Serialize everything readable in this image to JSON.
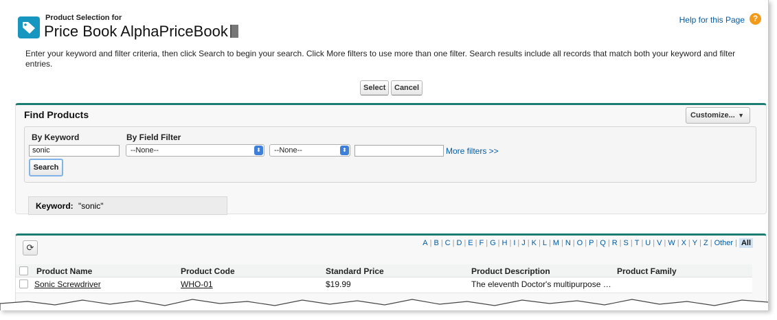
{
  "header": {
    "subtitle": "Product Selection for",
    "title": "Price Book AlphaPriceBook",
    "help_link": "Help for this Page",
    "help_icon": "?"
  },
  "instructions": "Enter your keyword and filter criteria, then click Search to begin your search. Click More filters to use more than one filter. Search results include all records that match both your keyword and filter entries.",
  "actions": {
    "select_label": "Select",
    "cancel_label": "Cancel"
  },
  "find_products": {
    "title": "Find Products",
    "customize_label": "Customize...",
    "by_keyword_label": "By Keyword",
    "by_field_filter_label": "By Field Filter",
    "keyword_value": "sonic",
    "field_select_value": "--None--",
    "operator_select_value": "--None--",
    "filter_value": "",
    "more_filters_link": "More filters >>",
    "search_label": "Search",
    "keyword_summary_label": "Keyword:",
    "keyword_summary_value": "\"sonic\""
  },
  "results": {
    "alphabet": [
      "A",
      "B",
      "C",
      "D",
      "E",
      "F",
      "G",
      "H",
      "I",
      "J",
      "K",
      "L",
      "M",
      "N",
      "O",
      "P",
      "Q",
      "R",
      "S",
      "T",
      "U",
      "V",
      "W",
      "X",
      "Y",
      "Z",
      "Other"
    ],
    "alphabet_all": "All",
    "columns": [
      "Product Name",
      "Product Code",
      "Standard Price",
      "Product Description",
      "Product Family"
    ],
    "rows": [
      {
        "name": "Sonic Screwdriver",
        "code": "WHO-01",
        "price": "$19.99",
        "description": "The eleventh Doctor's multipurpose …",
        "family": ""
      }
    ]
  },
  "colors": {
    "accent_border": "#1b7d72",
    "link": "#015ba7",
    "icon_bg": "#1797c0",
    "help_icon": "#f39a1b"
  }
}
